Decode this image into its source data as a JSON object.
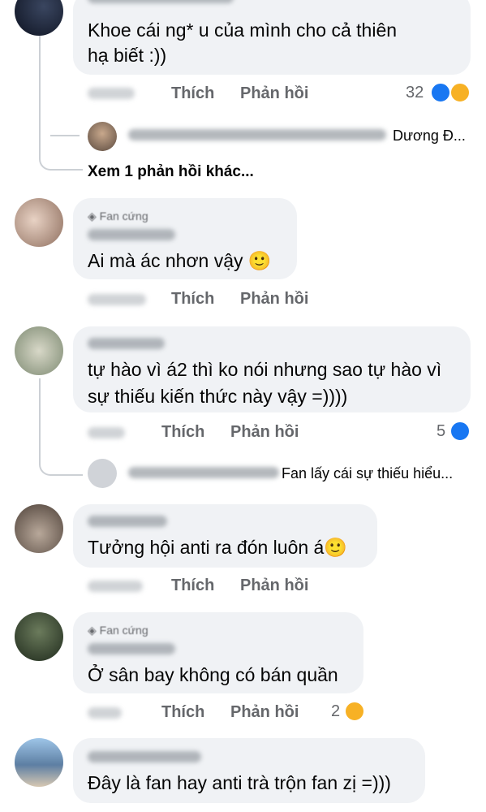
{
  "actions": {
    "like_label": "Thích",
    "reply_label": "Phản hồi"
  },
  "badge": {
    "fan_label": "Fan cứng"
  },
  "comments": [
    {
      "line1": "Khoe cái ng*      u của mình cho cả thiên",
      "line2": "hạ biết :))",
      "reaction_count": "32",
      "reactions": [
        "like-icon",
        "haha-icon"
      ]
    },
    {
      "line1": "Ai mà ác nhơn vậy 🙂"
    },
    {
      "line1": "tự hào vì á2 thì ko nói nhưng sao tự hào vì",
      "line2": "sự thiếu kiến thức này vậy =))))",
      "reaction_count": "5",
      "reactions": [
        "like-icon"
      ]
    },
    {
      "line1": "Tưởng hội anti ra đón luôn á🙂"
    },
    {
      "line1": "Ở sân bay không có bán quần",
      "reaction_count": "2",
      "reactions": [
        "haha-icon"
      ]
    },
    {
      "line1": "Đây là fan hay anti trà trộn fan zị =)))"
    }
  ],
  "replies": [
    {
      "preview": "Dương Đ..."
    },
    {
      "preview": "Fan lấy cái sự thiếu hiểu..."
    }
  ],
  "more_replies": {
    "label": "Xem 1 phản hồi khác..."
  },
  "colors": {
    "like": "#1877f2",
    "haha": "#f7b125",
    "bubble": "#f0f2f5",
    "meta": "#65676b"
  }
}
